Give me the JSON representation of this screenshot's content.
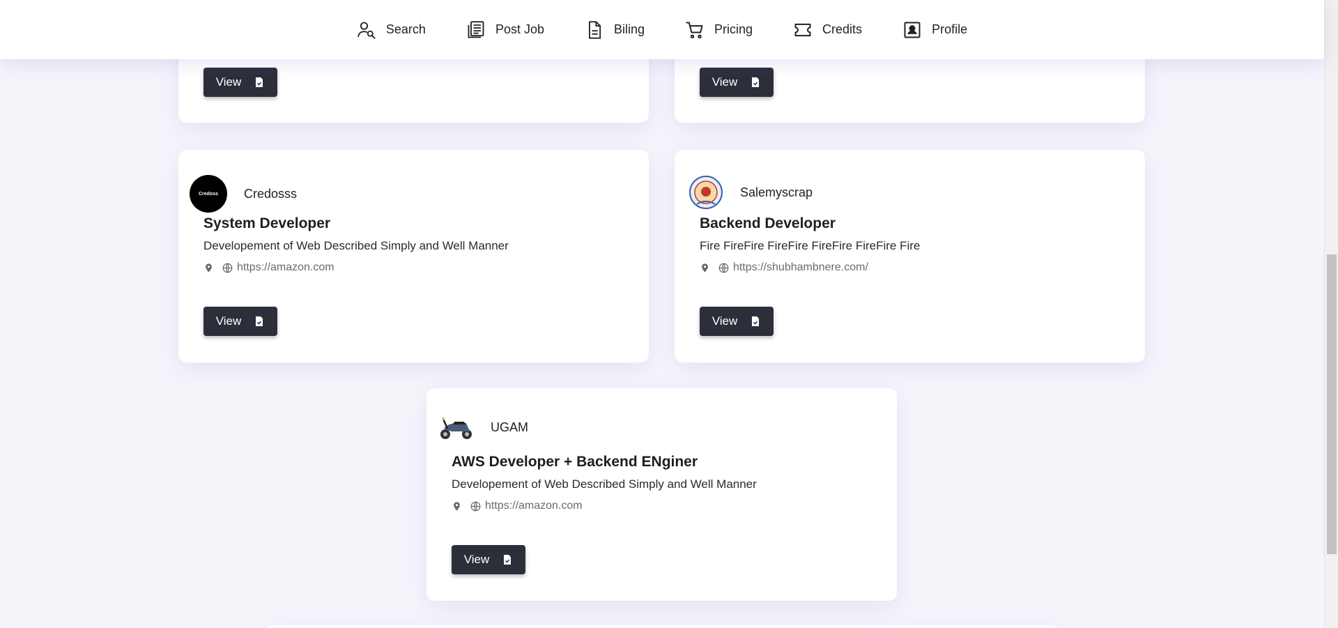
{
  "nav": {
    "items": [
      {
        "label": "Search",
        "icon": "user-search-icon"
      },
      {
        "label": "Post Job",
        "icon": "post-job-icon"
      },
      {
        "label": "Biling",
        "icon": "document-icon"
      },
      {
        "label": "Pricing",
        "icon": "cart-icon"
      },
      {
        "label": "Credits",
        "icon": "ticket-icon"
      },
      {
        "label": "Profile",
        "icon": "profile-icon"
      }
    ]
  },
  "cards": [
    {
      "view_label": "View"
    },
    {
      "view_label": "View"
    },
    {
      "company": "Credosss",
      "logo_text": "Credoss",
      "title": "System Developer",
      "description": "Developement of Web Described Simply and Well Manner",
      "website": "https://amazon.com",
      "view_label": "View"
    },
    {
      "company": "Salemyscrap",
      "title": "Backend Developer",
      "description": "Fire FireFire FireFire FireFire FireFire Fire",
      "website": "https://shubhambnere.com/",
      "view_label": "View"
    },
    {
      "company": "UGAM",
      "title": "AWS Developer + Backend ENginer",
      "description": "Developement of Web Described Simply and Well Manner",
      "website": "https://amazon.com",
      "view_label": "View"
    }
  ],
  "colors": {
    "accent": "#2b2f3a",
    "background": "#f5f4fb",
    "card": "#ffffff",
    "meta_text": "#666a72"
  }
}
